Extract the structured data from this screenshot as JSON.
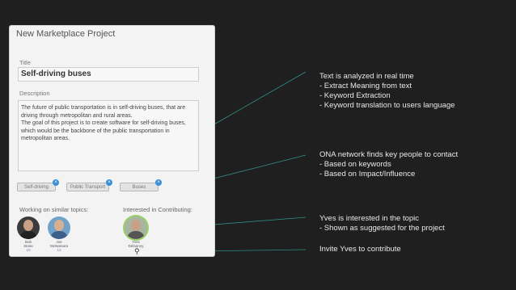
{
  "panel": {
    "title": "New Marketplace Project",
    "title_label": "Title",
    "title_value": "Self-driving buses",
    "description_label": "Description",
    "description_value": "The future of public transportation is in self-driving buses, that are driving through metropolitan and rural areas.\nThe goal of this project is to create software for self-driving buses, which would be the backbone of the public transportation in metropolitan areas.",
    "tags": [
      {
        "label": "Self-driving"
      },
      {
        "label": "Public Transport"
      },
      {
        "label": "Buses"
      }
    ],
    "similar_topics_label": "Working on similar topics:",
    "interested_label": "Interested in Contributing:",
    "people_similar": [
      {
        "name": "Bob\nStone",
        "count": "10"
      },
      {
        "name": "Joe\nMcNamara",
        "count": "13"
      }
    ],
    "people_interested": [
      {
        "name": "Yves\nDelannoy"
      }
    ]
  },
  "notes": [
    {
      "lines": [
        "Text is analyzed in real time",
        "-  Extract Meaning from text",
        "-  Keyword Extraction",
        "-  Keyword translation to users language"
      ]
    },
    {
      "lines": [
        "ONA network finds key people to contact",
        "-  Based on keywords",
        "-  Based on Impact/Influence"
      ]
    },
    {
      "lines": [
        "Yves is interested in the topic",
        "-  Shown as suggested for the project"
      ]
    },
    {
      "lines": [
        "Invite Yves to contribute"
      ]
    }
  ],
  "colors": {
    "accent": "#3a8fd6",
    "connector": "#2e8f86",
    "highlight": "#9ad06a"
  }
}
